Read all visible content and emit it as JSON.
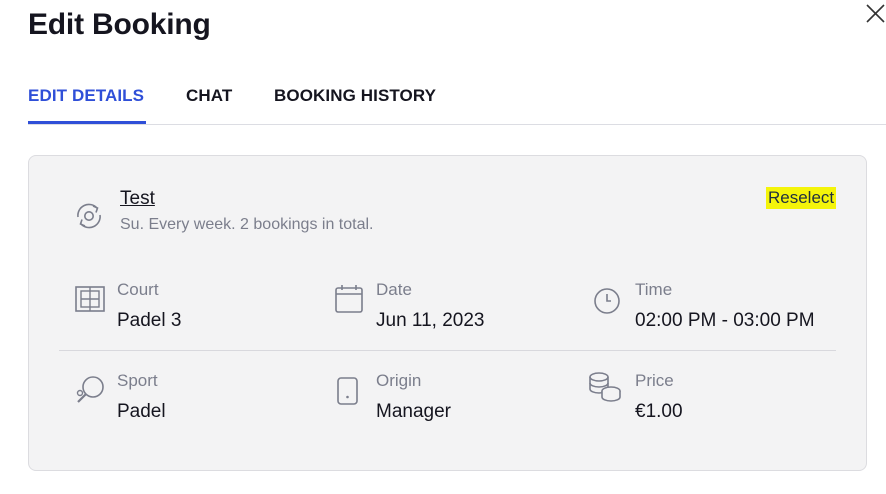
{
  "dialog": {
    "title": "Edit Booking"
  },
  "tabs": [
    {
      "label": "EDIT DETAILS",
      "active": true
    },
    {
      "label": "CHAT",
      "active": false
    },
    {
      "label": "BOOKING HISTORY",
      "active": false
    }
  ],
  "booking": {
    "name": "Test",
    "recurrence": "Su. Every week. 2 bookings in total.",
    "reselect_label": "Reselect"
  },
  "details": {
    "court": {
      "label": "Court",
      "value": "Padel 3",
      "icon": "court-icon"
    },
    "date": {
      "label": "Date",
      "value": "Jun 11, 2023",
      "icon": "calendar-icon"
    },
    "time": {
      "label": "Time",
      "value": "02:00 PM - 03:00 PM",
      "icon": "clock-icon"
    },
    "sport": {
      "label": "Sport",
      "value": "Padel",
      "icon": "padel-racket-icon"
    },
    "origin": {
      "label": "Origin",
      "value": "Manager",
      "icon": "mobile-device-icon"
    },
    "price": {
      "label": "Price",
      "value": "€1.00",
      "icon": "coins-icon"
    }
  },
  "colors": {
    "accent": "#2f4fd8",
    "highlight": "#f4f40a",
    "muted_text": "#7b7e8c",
    "card_bg": "#f3f3f4"
  }
}
